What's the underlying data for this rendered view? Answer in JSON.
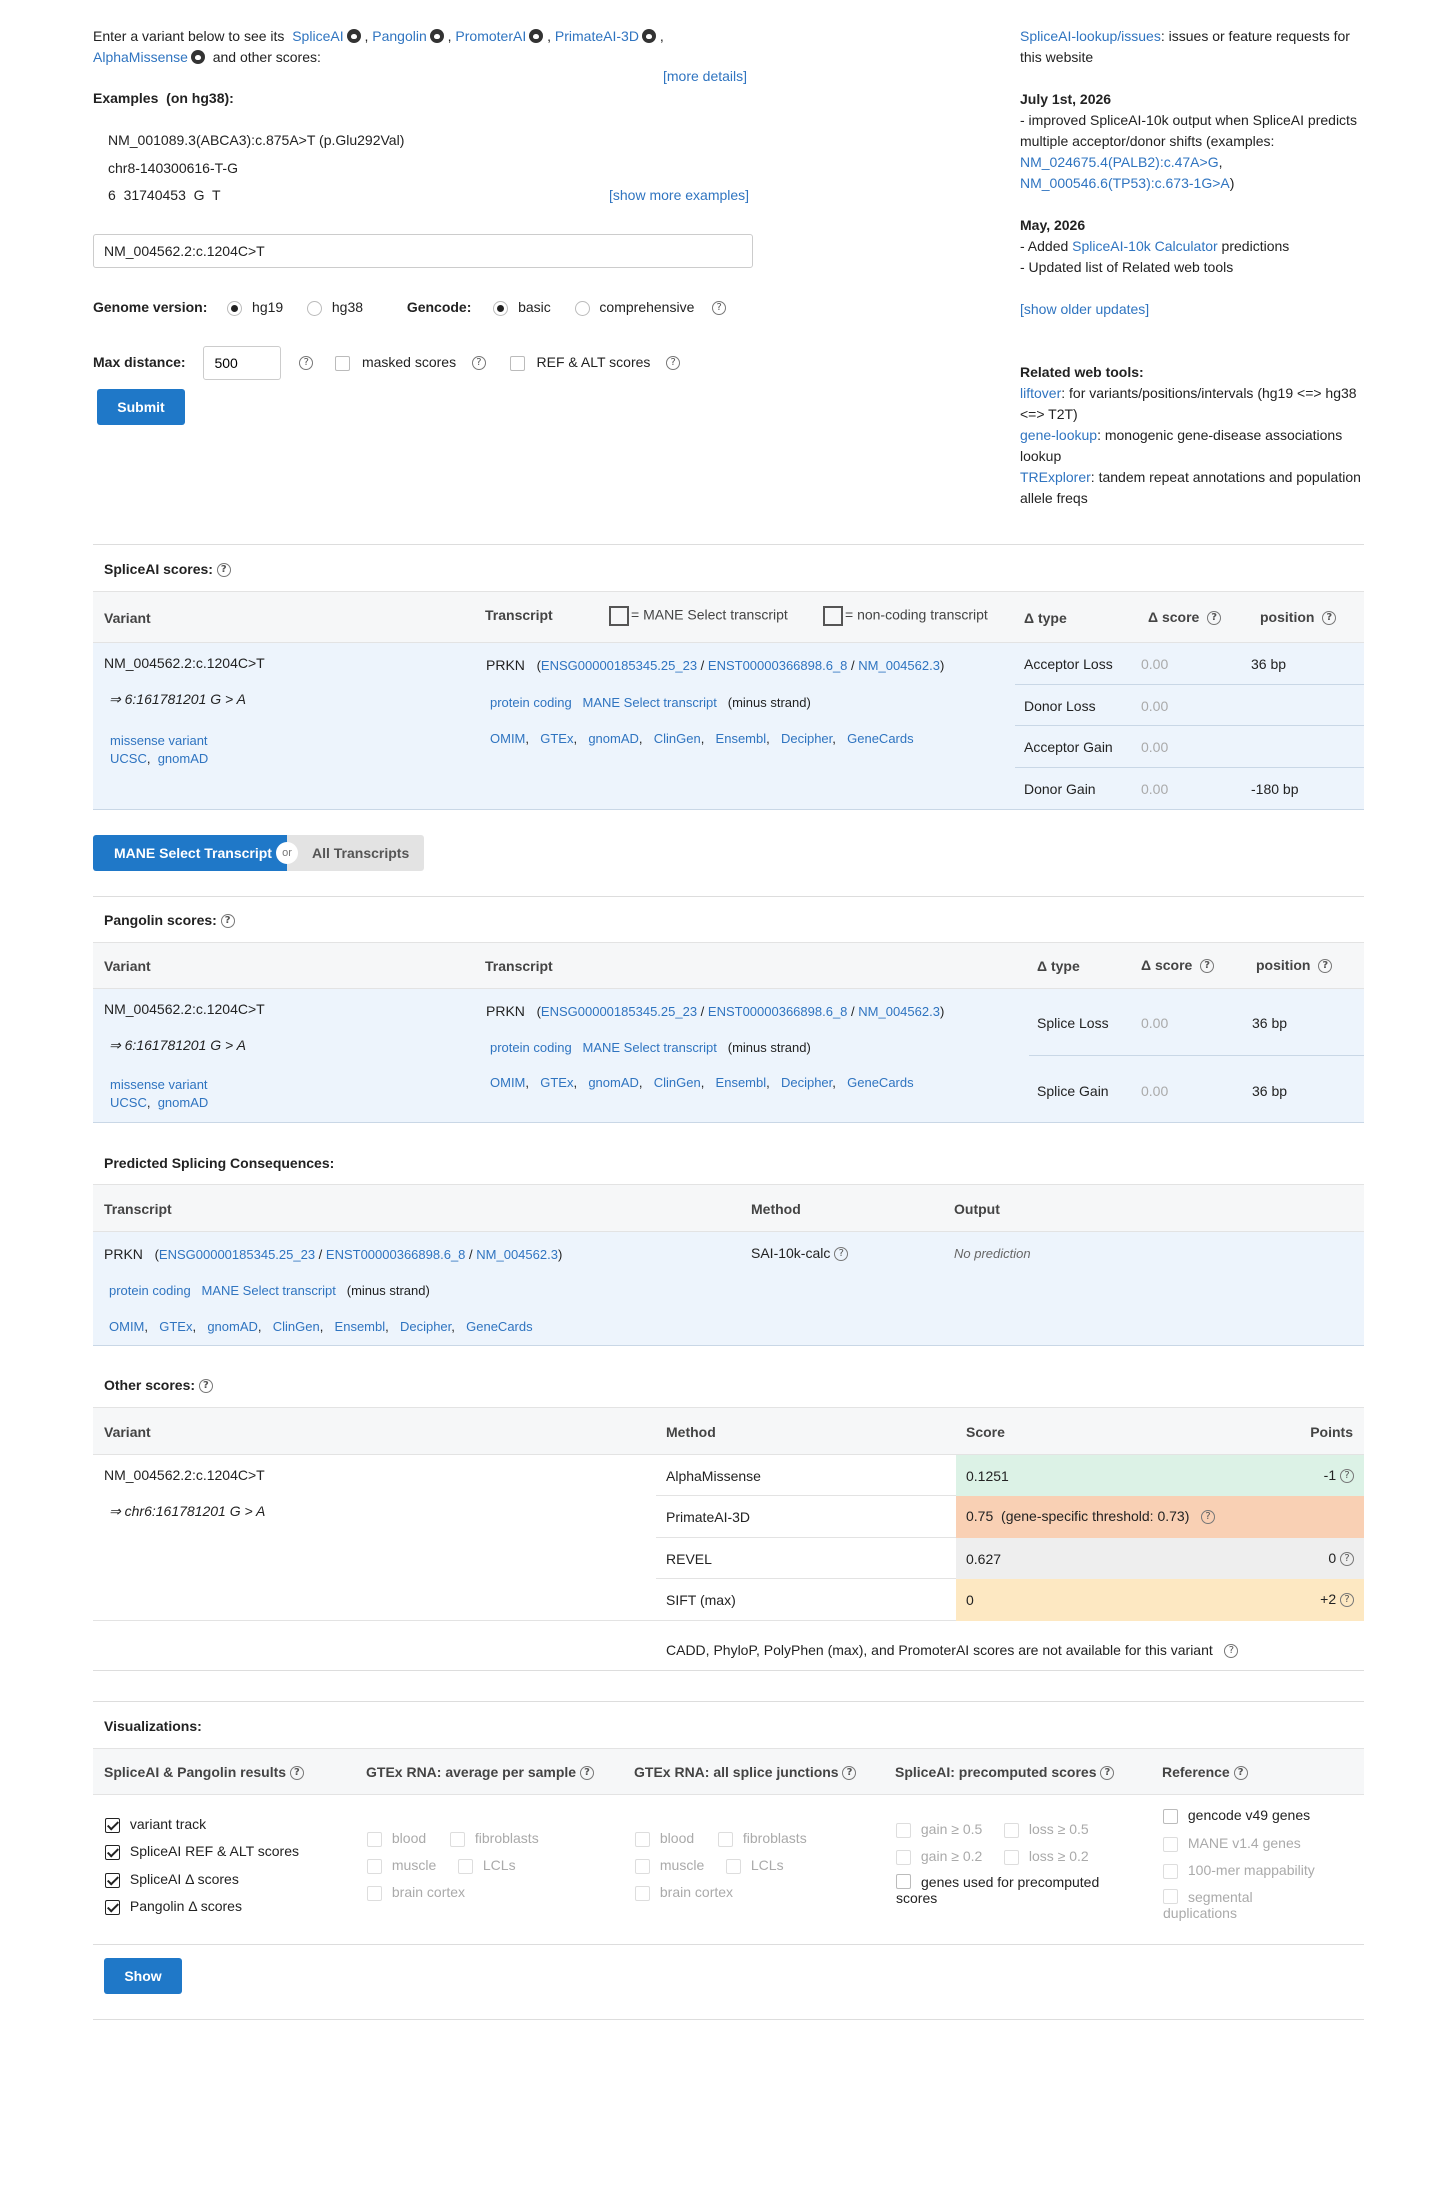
{
  "intro": {
    "text_before": "Enter a variant below to see its",
    "links": [
      "SpliceAI",
      "Pangolin",
      "PromoterAI",
      "PrimateAI-3D",
      "AlphaMissense"
    ],
    "text_after": "and other scores:",
    "more_details": "[more details]"
  },
  "examples": {
    "title": "Examples",
    "subtitle": "(on hg38):",
    "items": [
      "NM_001089.3(ABCA3):c.875A>T (p.Glu292Val)",
      "chr8-140300616-T-G",
      "6  31740453  G  T"
    ],
    "show_more": "[show more examples]"
  },
  "search": {
    "value": "NM_004562.2:c.1204C>T"
  },
  "options": {
    "genome_label": "Genome version:",
    "genome_options": [
      "hg19",
      "hg38"
    ],
    "gencode_label": "Gencode:",
    "gencode_options": [
      "basic",
      "comprehensive"
    ],
    "maxdist_label": "Max distance:",
    "maxdist_value": "500",
    "masked_label": "masked scores",
    "refalt_label": "REF & ALT scores",
    "submit": "Submit"
  },
  "sidebar": {
    "issues_link": "SpliceAI-lookup/issues",
    "issues_text": ": issues or feature requests for this website",
    "update1_date": "July 1st, 2026",
    "update1_text": "- improved SpliceAI-10k output when SpliceAI predicts multiple acceptor/donor shifts (examples:",
    "update1_link1": "NM_024675.4(PALB2):c.47A>G",
    "update1_link2": "NM_000546.6(TP53):c.673-1G>A",
    "update2_date": "May, 2026",
    "update2_pre": "- Added ",
    "update2_link": "SpliceAI-10k Calculator",
    "update2_post": " predictions",
    "update2_line2": "- Updated list of Related web tools",
    "show_older": "[show older updates]",
    "related_title": "Related web tools:",
    "tools": [
      {
        "name": "liftover",
        "desc": ": for variants/positions/intervals (hg19 <=> hg38 <=> T2T)"
      },
      {
        "name": "gene-lookup",
        "desc": ": monogenic gene-disease associations lookup"
      },
      {
        "name": "TRExplorer",
        "desc": ": tandem repeat annotations and population allele freqs"
      }
    ]
  },
  "common": {
    "variant": "NM_004562.2:c.1204C>T",
    "coord": "⇒ 6:161781201 G > A",
    "coord_chr": "⇒ chr6:161781201 G > A",
    "missense": "missense variant",
    "ucsc": "UCSC",
    "gnomad": "gnomAD",
    "gene": "PRKN",
    "ensg": "ENSG00000185345.25_23",
    "enst": "ENST00000366898.6_8",
    "nm": "NM_004562.3",
    "protein_coding": "protein coding",
    "mane_select": "MANE Select transcript",
    "strand": "(minus strand)",
    "gene_links": [
      "OMIM",
      "GTEx",
      "gnomAD",
      "ClinGen",
      "Ensembl",
      "Decipher",
      "GeneCards"
    ]
  },
  "spliceai": {
    "title": "SpliceAI scores:",
    "headers": {
      "variant": "Variant",
      "transcript": "Transcript",
      "mane_legend": "= MANE Select transcript",
      "noncoding_legend": "= non-coding transcript",
      "dtype": "Δ type",
      "dscore": "Δ score",
      "position": "position"
    },
    "rows": [
      {
        "type": "Acceptor Loss",
        "score": "0.00",
        "position": "36 bp"
      },
      {
        "type": "Donor Loss",
        "score": "0.00",
        "position": ""
      },
      {
        "type": "Acceptor Gain",
        "score": "0.00",
        "position": ""
      },
      {
        "type": "Donor Gain",
        "score": "0.00",
        "position": "-180 bp"
      }
    ]
  },
  "toggle": {
    "mane": "MANE Select Transcript",
    "or": "or",
    "all": "All Transcripts"
  },
  "pangolin": {
    "title": "Pangolin scores:",
    "headers": {
      "variant": "Variant",
      "transcript": "Transcript",
      "dtype": "Δ type",
      "dscore": "Δ score",
      "position": "position"
    },
    "rows": [
      {
        "type": "Splice Loss",
        "score": "0.00",
        "position": "36 bp"
      },
      {
        "type": "Splice Gain",
        "score": "0.00",
        "position": "36 bp"
      }
    ]
  },
  "consequences": {
    "title": "Predicted Splicing Consequences:",
    "headers": {
      "transcript": "Transcript",
      "method": "Method",
      "output": "Output"
    },
    "method": "SAI-10k-calc",
    "output": "No prediction"
  },
  "other": {
    "title": "Other scores:",
    "headers": {
      "variant": "Variant",
      "method": "Method",
      "score": "Score",
      "points": "Points"
    },
    "rows": [
      {
        "method": "AlphaMissense",
        "score": "0.1251",
        "points": "-1",
        "color": "#dcf2e6"
      },
      {
        "method": "PrimateAI-3D",
        "score": "0.75  (gene-specific threshold: 0.73)",
        "points": "",
        "color": "#f9d0b4"
      },
      {
        "method": "REVEL",
        "score": "0.627",
        "points": "0",
        "color": "#eeeeee"
      },
      {
        "method": "SIFT (max)",
        "score": "0",
        "points": "+2",
        "color": "#fde8c2"
      }
    ],
    "note": "CADD,  PhyloP,  PolyPhen (max),  and PromoterAI scores are not available for this variant"
  },
  "viz": {
    "title": "Visualizations:",
    "headers": [
      "SpliceAI & Pangolin results",
      "GTEx RNA: average per sample",
      "GTEx RNA: all splice junctions",
      "SpliceAI: precomputed scores",
      "Reference"
    ],
    "col1": [
      "variant track",
      "SpliceAI REF & ALT scores",
      "SpliceAI Δ  scores",
      "Pangolin Δ  scores"
    ],
    "tissues": [
      "blood",
      "fibroblasts",
      "muscle",
      "LCLs",
      "brain cortex"
    ],
    "precomp": [
      "gain ≥ 0.5",
      "loss ≥ 0.5",
      "gain ≥ 0.2",
      "loss ≥ 0.2",
      "genes used for precomputed scores"
    ],
    "reference": [
      "gencode v49 genes",
      "MANE v1.4 genes",
      "100-mer mappability",
      "segmental duplications"
    ],
    "show": "Show"
  }
}
